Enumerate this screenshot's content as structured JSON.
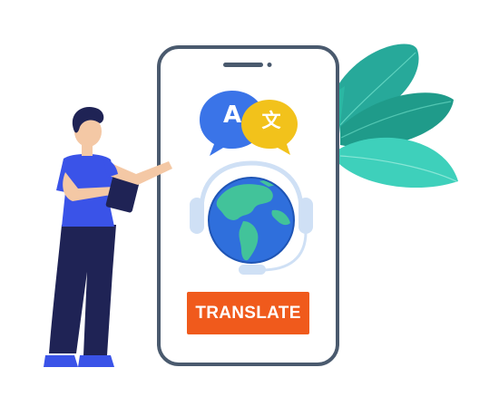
{
  "phone": {
    "button_label": "TRANSLATE"
  },
  "bubbles": {
    "latin_glyph": "A",
    "cjk_glyph": "文"
  },
  "icons": [
    "speech-bubble-icon",
    "globe-icon",
    "headset-icon",
    "leaf-icon",
    "tablet-icon"
  ],
  "colors": {
    "button": "#f05a1c",
    "bubble_blue": "#3a74e8",
    "bubble_yellow": "#f2c21b",
    "globe_ocean": "#2f6fdc",
    "globe_land": "#42c39a",
    "leaf": "#2fb39a",
    "shirt": "#3a53e8",
    "pants": "#1f2355",
    "phone_outline": "#4a5a6e"
  }
}
